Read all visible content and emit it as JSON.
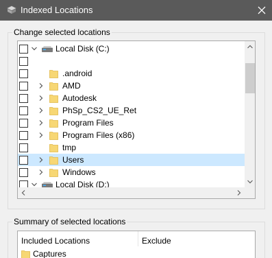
{
  "window": {
    "title": "Indexed Locations"
  },
  "group_change": {
    "label": "Change selected locations"
  },
  "tree": {
    "rows": [
      {
        "kind": "disk",
        "label": "Local Disk (C:)",
        "expander": "expanded",
        "selected": false,
        "checkbox_only": false
      },
      {
        "kind": "blank",
        "label": "",
        "expander": "none",
        "selected": false,
        "checkbox_only": true
      },
      {
        "kind": "folder",
        "label": ".android",
        "expander": "none",
        "selected": false,
        "checkbox_only": false
      },
      {
        "kind": "folder",
        "label": "AMD",
        "expander": "collapsed",
        "selected": false,
        "checkbox_only": false
      },
      {
        "kind": "folder",
        "label": "Autodesk",
        "expander": "collapsed",
        "selected": false,
        "checkbox_only": false
      },
      {
        "kind": "folder",
        "label": "PhSp_CS2_UE_Ret",
        "expander": "collapsed",
        "selected": false,
        "checkbox_only": false
      },
      {
        "kind": "folder",
        "label": "Program Files",
        "expander": "collapsed",
        "selected": false,
        "checkbox_only": false
      },
      {
        "kind": "folder",
        "label": "Program Files (x86)",
        "expander": "collapsed",
        "selected": false,
        "checkbox_only": false
      },
      {
        "kind": "folder",
        "label": "tmp",
        "expander": "none",
        "selected": false,
        "checkbox_only": false
      },
      {
        "kind": "folder",
        "label": "Users",
        "expander": "collapsed",
        "selected": true,
        "checkbox_only": false
      },
      {
        "kind": "folder",
        "label": "Windows",
        "expander": "collapsed",
        "selected": false,
        "checkbox_only": false
      },
      {
        "kind": "disk",
        "label": "Local Disk (D:)",
        "expander": "expanded",
        "selected": false,
        "checkbox_only": false
      }
    ]
  },
  "group_summary": {
    "label": "Summary of selected locations"
  },
  "summary": {
    "col_included": "Included Locations",
    "col_exclude": "Exclude",
    "items": [
      {
        "label": "Captures"
      }
    ]
  },
  "colors": {
    "titlebar": "#5a5a5a",
    "selection": "#cce8ff",
    "folder": "#f7d774"
  }
}
